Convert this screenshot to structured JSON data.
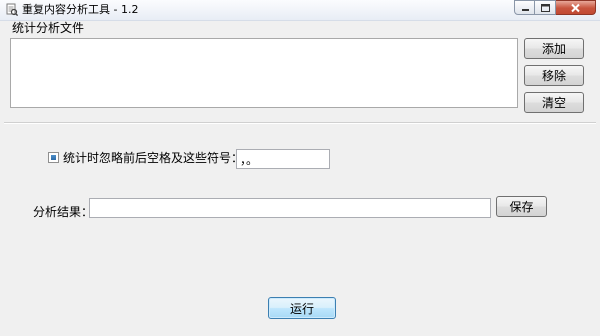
{
  "window": {
    "title": "重复内容分析工具 - 1.2"
  },
  "files_section": {
    "label": "统计分析文件",
    "add_label": "添加",
    "remove_label": "移除",
    "clear_label": "清空"
  },
  "options": {
    "ignore_label": "统计时忽略前后空格及这些符号：",
    "ignore_checked": true,
    "symbols_value": "，。"
  },
  "result": {
    "label": "分析结果：",
    "value": "",
    "save_label": "保存"
  },
  "run_label": "运行",
  "colors": {
    "window_bg": "#f0f0f0",
    "run_button_border": "#3c7fb1",
    "close_button": "#c8543e"
  }
}
